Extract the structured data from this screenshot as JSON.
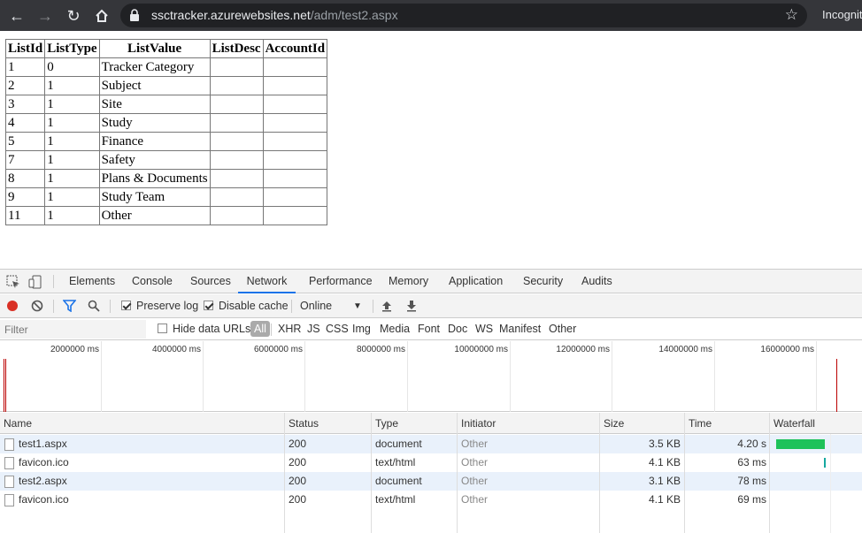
{
  "browser": {
    "url_host": "ssctracker.azurewebsites.net",
    "url_path": "/adm/test2.aspx",
    "incognito_label": "Incognit"
  },
  "page_table": {
    "headers": [
      "ListId",
      "ListType",
      "ListValue",
      "ListDesc",
      "AccountId"
    ],
    "rows": [
      [
        "1",
        "0",
        "Tracker Category",
        "",
        ""
      ],
      [
        "2",
        "1",
        "Subject",
        "",
        ""
      ],
      [
        "3",
        "1",
        "Site",
        "",
        ""
      ],
      [
        "4",
        "1",
        "Study",
        "",
        ""
      ],
      [
        "5",
        "1",
        "Finance",
        "",
        ""
      ],
      [
        "7",
        "1",
        "Safety",
        "",
        ""
      ],
      [
        "8",
        "1",
        "Plans & Documents",
        "",
        ""
      ],
      [
        "9",
        "1",
        "Study Team",
        "",
        ""
      ],
      [
        "11",
        "1",
        "Other",
        "",
        ""
      ]
    ]
  },
  "devtools": {
    "tabs": [
      "Elements",
      "Console",
      "Sources",
      "Network",
      "Performance",
      "Memory",
      "Application",
      "Security",
      "Audits"
    ],
    "active_tab": "Network",
    "toolbar": {
      "preserve_log": "Preserve log",
      "disable_cache": "Disable cache",
      "throttle": "Online"
    },
    "filter": {
      "placeholder": "Filter",
      "hide_data_urls": "Hide data URLs",
      "types": [
        "All",
        "XHR",
        "JS",
        "CSS",
        "Img",
        "Media",
        "Font",
        "Doc",
        "WS",
        "Manifest",
        "Other"
      ]
    },
    "overview_ticks": [
      "2000000 ms",
      "4000000 ms",
      "6000000 ms",
      "8000000 ms",
      "10000000 ms",
      "12000000 ms",
      "14000000 ms",
      "16000000 ms"
    ],
    "columns": [
      "Name",
      "Status",
      "Type",
      "Initiator",
      "Size",
      "Time",
      "Waterfall"
    ],
    "requests": [
      {
        "name": "test1.aspx",
        "status": "200",
        "type": "document",
        "initiator": "Other",
        "size": "3.5 KB",
        "time": "4.20 s"
      },
      {
        "name": "favicon.ico",
        "status": "200",
        "type": "text/html",
        "initiator": "Other",
        "size": "4.1 KB",
        "time": "63 ms"
      },
      {
        "name": "test2.aspx",
        "status": "200",
        "type": "document",
        "initiator": "Other",
        "size": "3.1 KB",
        "time": "78 ms"
      },
      {
        "name": "favicon.ico",
        "status": "200",
        "type": "text/html",
        "initiator": "Other",
        "size": "4.1 KB",
        "time": "69 ms"
      }
    ],
    "colors": {
      "accent": "#1a73e8",
      "record": "#d93025",
      "waterfall": "#1ec25a"
    }
  }
}
